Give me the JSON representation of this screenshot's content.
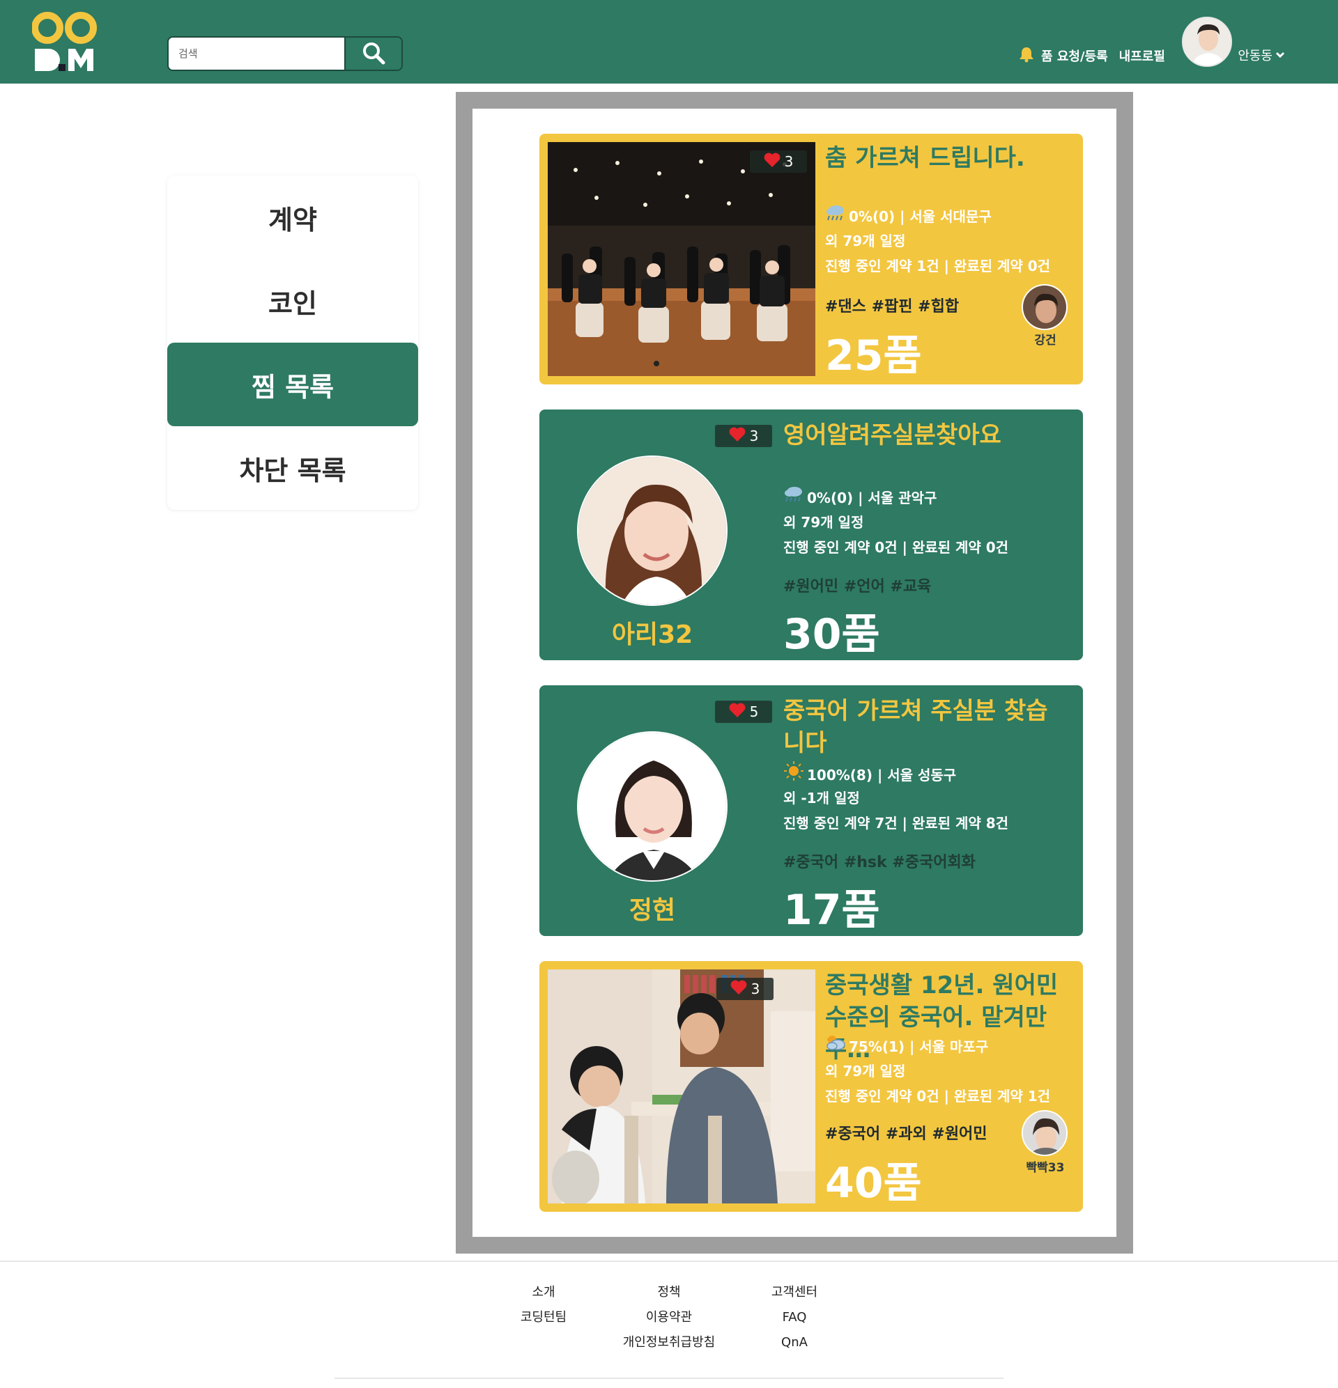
{
  "header": {
    "search_placeholder": "검색",
    "nav": {
      "request_label": "품 요청/등록",
      "profile_label": "내프로필",
      "user_name": "안동동"
    }
  },
  "sidebar": {
    "items": [
      {
        "label": "계약",
        "active": false
      },
      {
        "label": "코인",
        "active": false
      },
      {
        "label": "찜 목록",
        "active": true
      },
      {
        "label": "차단 목록",
        "active": false
      }
    ]
  },
  "cards": [
    {
      "title": "춤 가르쳐 드립니다.",
      "likes": "3",
      "weather": "0%(0) | 서울 서대문구",
      "schedule": "외 79개 일정",
      "contracts": "진행 중인 계약 1건 | 완료된 계약 0건",
      "tags": "#댄스 #팝핀 #힙합",
      "price": "25품",
      "author": "강건"
    },
    {
      "title": "영어알려주실분찾아요",
      "likes": "3",
      "weather": "0%(0) | 서울 관악구",
      "schedule": "외 79개 일정",
      "contracts": "진행 중인 계약 0건 | 완료된 계약 0건",
      "tags": "#원어민 #언어 #교육",
      "price": "30품",
      "author": "아리32"
    },
    {
      "title": "중국어 가르쳐 주실분 찾습니다",
      "likes": "5",
      "weather": "100%(8) | 서울 성동구",
      "schedule": "외 -1개 일정",
      "contracts": "진행 중인 계약 7건 | 완료된 계약 8건",
      "tags": "#중국어 #hsk #중국어회화",
      "price": "17품",
      "author": "정현"
    },
    {
      "title": "중국생활 12년. 원어민 수준의 중국어. 맡겨만 주…",
      "likes": "3",
      "weather": "75%(1) | 서울 마포구",
      "schedule": "외 79개 일정",
      "contracts": "진행 중인 계약 0건 | 완료된 계약 1건",
      "tags": "#중국어 #과외 #원어민",
      "price": "40품",
      "author": "빡빡33"
    }
  ],
  "footer": {
    "col1": [
      "소개",
      "코딩턴팀"
    ],
    "col2": [
      "정책",
      "이용약관",
      "개인정보취급방침"
    ],
    "col3": [
      "고객센터",
      "FAQ",
      "QnA"
    ]
  },
  "colors": {
    "brand_green": "#2e7a62",
    "brand_yellow": "#f3c640",
    "frame_gray": "#9e9e9e"
  }
}
